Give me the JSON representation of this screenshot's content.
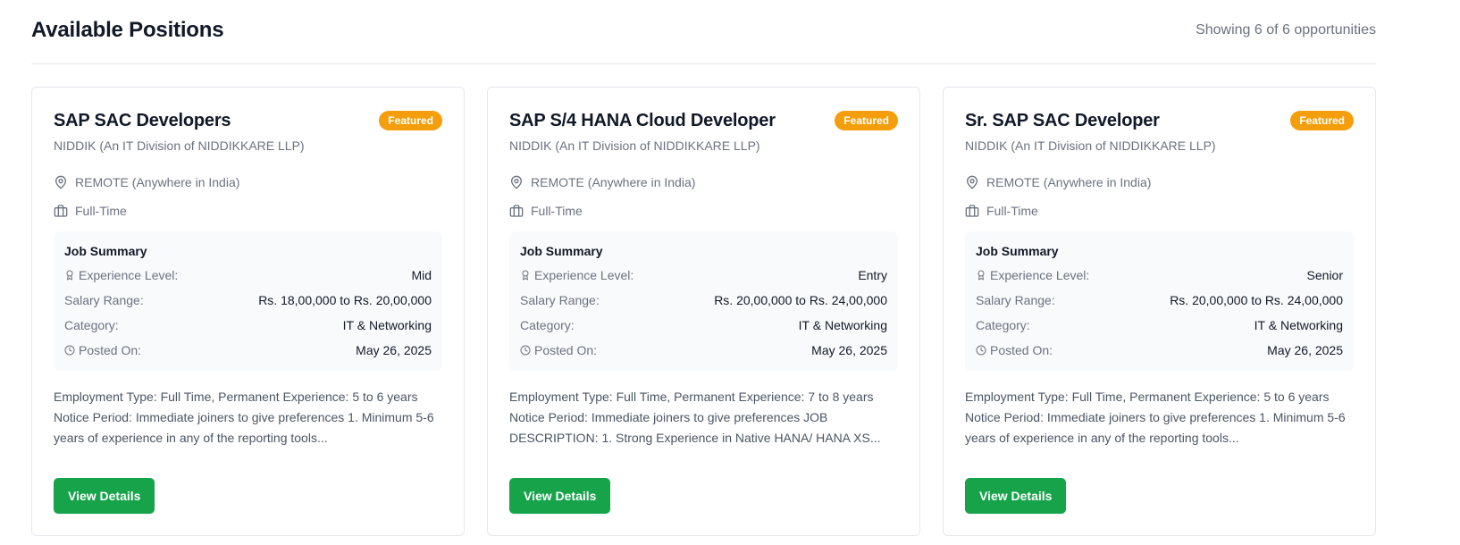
{
  "header": {
    "title": "Available Positions",
    "count_text": "Showing 6 of 6 opportunities"
  },
  "icons": {
    "location": "map-pin-icon",
    "job_type": "briefcase-icon",
    "experience": "award-icon",
    "posted": "clock-icon"
  },
  "colors": {
    "featured_badge": "#f59e0b",
    "view_button": "#16a34a"
  },
  "cards": [
    {
      "title": "SAP SAC Developers",
      "badge": "Featured",
      "company": "NIDDIK (An IT Division of NIDDIKKARE LLP)",
      "location": "REMOTE (Anywhere in India)",
      "job_type": "Full-Time",
      "summary_title": "Job Summary",
      "experience_label": "Experience Level:",
      "experience": "Mid",
      "salary_label": "Salary Range:",
      "salary": "Rs. 18,00,000 to Rs. 20,00,000",
      "category_label": "Category:",
      "category": "IT & Networking",
      "posted_label": "Posted On:",
      "posted": "May 26, 2025",
      "description": "Employment Type: Full Time, Permanent Experience: 5 to 6 years Notice Period: Immediate joiners to give preferences 1. Minimum 5-6 years of experience in any of the reporting tools...",
      "button": "View Details"
    },
    {
      "title": "SAP S/4 HANA Cloud Developer",
      "badge": "Featured",
      "company": "NIDDIK (An IT Division of NIDDIKKARE LLP)",
      "location": "REMOTE (Anywhere in India)",
      "job_type": "Full-Time",
      "summary_title": "Job Summary",
      "experience_label": "Experience Level:",
      "experience": "Entry",
      "salary_label": "Salary Range:",
      "salary": "Rs. 20,00,000 to Rs. 24,00,000",
      "category_label": "Category:",
      "category": "IT & Networking",
      "posted_label": "Posted On:",
      "posted": "May 26, 2025",
      "description": "Employment Type: Full Time, Permanent Experience: 7 to 8 years Notice Period: Immediate joiners to give preferences JOB DESCRIPTION: 1. Strong Experience in Native HANA/ HANA XS...",
      "button": "View Details"
    },
    {
      "title": "Sr. SAP SAC Developer",
      "badge": "Featured",
      "company": "NIDDIK (An IT Division of NIDDIKKARE LLP)",
      "location": "REMOTE (Anywhere in India)",
      "job_type": "Full-Time",
      "summary_title": "Job Summary",
      "experience_label": "Experience Level:",
      "experience": "Senior",
      "salary_label": "Salary Range:",
      "salary": "Rs. 20,00,000 to Rs. 24,00,000",
      "category_label": "Category:",
      "category": "IT & Networking",
      "posted_label": "Posted On:",
      "posted": "May 26, 2025",
      "description": "Employment Type: Full Time, Permanent Experience: 5 to 6 years Notice Period: Immediate joiners to give preferences 1. Minimum 5-6 years of experience in any of the reporting tools...",
      "button": "View Details"
    }
  ]
}
